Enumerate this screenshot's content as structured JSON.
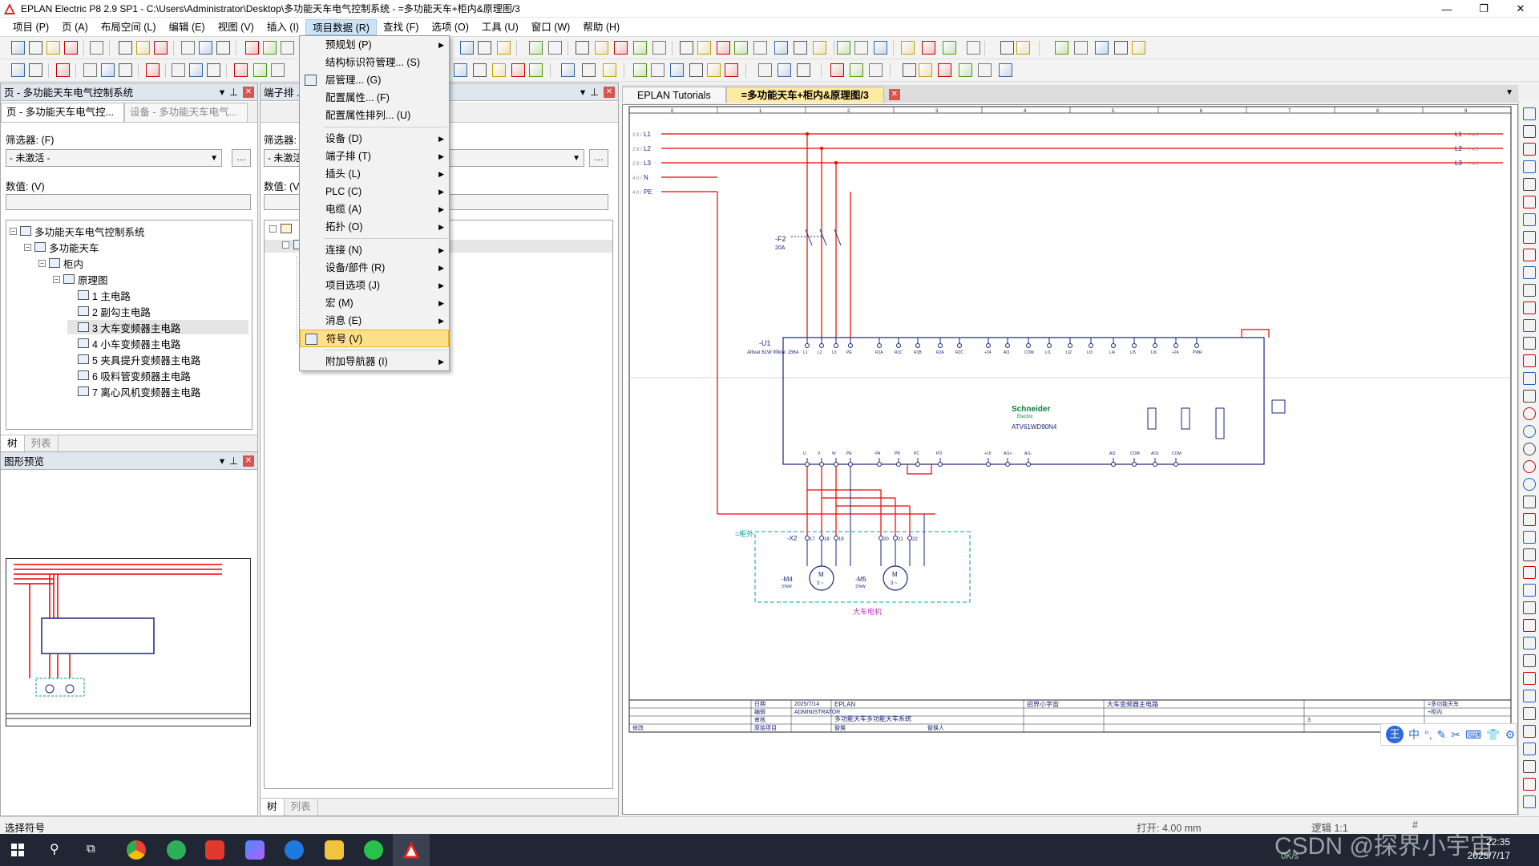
{
  "window": {
    "title": "EPLAN Electric P8 2.9 SP1 - C:\\Users\\Administrator\\Desktop\\多功能天车电气控制系统 - =多功能天车+柜内&原理图/3"
  },
  "menubar": [
    "项目 (P)",
    "页 (A)",
    "布局空间 (L)",
    "编辑 (E)",
    "视图 (V)",
    "插入 (I)",
    "项目数据 (R)",
    "查找 (F)",
    "选项 (O)",
    "工具 (U)",
    "窗口 (W)",
    "帮助 (H)"
  ],
  "menu_active_index": 6,
  "dropdown": {
    "groups": [
      [
        {
          "label": "预规划 (P)",
          "submenu": true
        },
        {
          "label": "结构标识符管理... (S)",
          "submenu": false
        },
        {
          "label": "层管理... (G)",
          "submenu": false
        },
        {
          "label": "配置属性... (F)",
          "submenu": false
        },
        {
          "label": "配置属性排列... (U)",
          "submenu": false
        }
      ],
      [
        {
          "label": "设备 (D)",
          "submenu": true
        },
        {
          "label": "端子排 (T)",
          "submenu": true
        },
        {
          "label": "插头 (L)",
          "submenu": true
        },
        {
          "label": "PLC (C)",
          "submenu": true
        },
        {
          "label": "电缆 (A)",
          "submenu": true
        },
        {
          "label": "拓扑 (O)",
          "submenu": true
        }
      ],
      [
        {
          "label": "连接 (N)",
          "submenu": true
        },
        {
          "label": "设备/部件 (R)",
          "submenu": true
        },
        {
          "label": "项目选项 (J)",
          "submenu": true
        },
        {
          "label": "宏 (M)",
          "submenu": true
        },
        {
          "label": "消息 (E)",
          "submenu": true
        },
        {
          "label": "符号 (V)",
          "submenu": false,
          "highlighted": true
        }
      ],
      [
        {
          "label": "附加导航器 (I)",
          "submenu": true
        }
      ]
    ]
  },
  "pages_panel": {
    "title": "页 - 多功能天车电气控制系统",
    "tabs": [
      "页 - 多功能天车电气控...",
      "设备 - 多功能天车电气..."
    ],
    "filter_label": "筛选器: (F)",
    "filter_value": "- 未激活 -",
    "value_label": "数值: (V)",
    "tree": [
      {
        "label": "多功能天车电气控制系统",
        "level": 0
      },
      {
        "label": "多功能天车",
        "level": 1
      },
      {
        "label": "柜内",
        "level": 2
      },
      {
        "label": "原理图",
        "level": 3
      },
      {
        "label": "1 主电路",
        "level": 4
      },
      {
        "label": "2 副勾主电路",
        "level": 4
      },
      {
        "label": "3 大车变频器主电路",
        "level": 4,
        "selected": true
      },
      {
        "label": "4 小车变频器主电路",
        "level": 4
      },
      {
        "label": "5 夹具提升变频器主电路",
        "level": 4
      },
      {
        "label": "6 吸料管变频器主电路",
        "level": 4
      },
      {
        "label": "7 离心风机变频器主电路",
        "level": 4
      }
    ],
    "bottom_tabs": [
      "树",
      "列表"
    ]
  },
  "preview_panel": {
    "title": "图形预览"
  },
  "terminal_panel": {
    "title": "端子排 ...",
    "filter_label": "筛选器: (I",
    "filter_value": "- 未激活",
    "value_label": "数值: (V)",
    "bottom_tabs": [
      "树",
      "列表"
    ]
  },
  "doc_tabs": [
    {
      "label": "EPLAN Tutorials",
      "active": false
    },
    {
      "label": "=多功能天车+柜内&原理图/3",
      "active": true
    }
  ],
  "schematic": {
    "columns": [
      "0",
      "1",
      "2",
      "3",
      "4",
      "5",
      "6",
      "7",
      "8",
      "9"
    ],
    "left_bus": [
      {
        "ref": "2.9 /",
        "name": "L1"
      },
      {
        "ref": "2.9 /",
        "name": "L2"
      },
      {
        "ref": "2.9 /",
        "name": "L3"
      },
      {
        "ref": "4.0 /",
        "name": "N"
      },
      {
        "ref": "4.0 /",
        "name": "PE"
      }
    ],
    "right_bus": [
      {
        "name": "L1",
        "ref": "/ 4.0"
      },
      {
        "name": "L2",
        "ref": "/ 4.0"
      },
      {
        "name": "L3",
        "ref": "/ 4.0"
      }
    ],
    "fuse": {
      "tag": "-F2",
      "sub": "20A"
    },
    "vfd": {
      "tag": "-U1",
      "brand": "Schneider",
      "brand_sub": "Electric",
      "model": "ATV61WD90N4",
      "desc": "Altivar 61W 90kW, 156A"
    },
    "vfd_top_terminals": [
      "L1",
      "L2",
      "L3",
      "PE",
      "R1A",
      "R1C",
      "R1B",
      "R2A",
      "R2C",
      "+24",
      "AI1",
      "COM",
      "LI1",
      "LI2",
      "LI3",
      "LI4",
      "LI5",
      "LI6",
      "+24",
      "PWR"
    ],
    "vfd_bottom_terminals": [
      "U",
      "V",
      "W",
      "PE",
      "PA",
      "PB",
      "PC",
      "PO",
      "+10",
      "AI1+",
      "AI1-",
      "AI2",
      "COM",
      "AO1",
      "COM"
    ],
    "terminal_strip": {
      "tag": "-X2",
      "numbers": [
        "17",
        "18",
        "19",
        "20",
        "21",
        "22"
      ]
    },
    "cabinet_label": "=柜外",
    "motors": [
      {
        "tag": "-M4",
        "power": "37kW",
        "label": "M",
        "sub": "3 ~"
      },
      {
        "tag": "-M5",
        "power": "37kW",
        "label": "M",
        "sub": "3 ~"
      }
    ],
    "motor_caption": "大车电机"
  },
  "title_block": {
    "date_label": "日期",
    "date": "2025/7/14",
    "editor_label": "编辑",
    "editor": "ADMINISTRATOR",
    "check_label": "审核",
    "company": "EPLAN",
    "project": "多功能天车多功能天车系统",
    "author": "招界小字宙",
    "page_desc": "大车变频器主电路",
    "plant": "=多功能天车",
    "location": "+柜内",
    "page_no": "3",
    "modify_label": "修改",
    "name_label": "原始项目",
    "origin_label": "替换",
    "replaced_label": "替换人"
  },
  "statusbar": {
    "left": "选择符号",
    "open": "打开: 4.00 mm",
    "logic": "逻辑 1:1",
    "hash": "#"
  },
  "taskbar": {
    "time": "22:35",
    "date": "2025/7/17",
    "net": "0K/s"
  },
  "ime": {
    "label": "中"
  },
  "watermark": "CSDN @探界小宇宙",
  "colors": {
    "accent": "#ffe08a",
    "wire": "#e00000",
    "schematic_blue": "#1a237e",
    "cabinet": "#00a0a0"
  }
}
